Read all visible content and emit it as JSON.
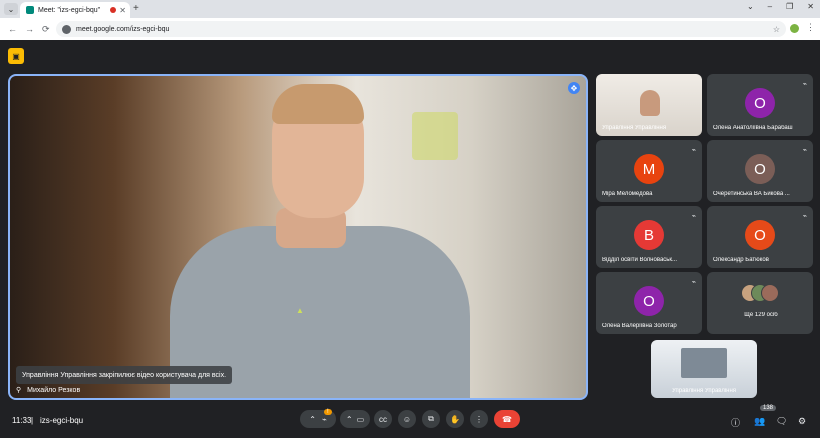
{
  "browser": {
    "tab_title": "Meet: \"izs-egci-bqu\"",
    "new_tab": "+",
    "url": "meet.google.com/izs-egci-bqu",
    "win_controls": [
      "⌄",
      "–",
      "❐",
      "✕"
    ]
  },
  "main": {
    "pin_notice": "Управління Управління закріпилює відео користувача для всіх.",
    "speaker_name": "Михайло Резков"
  },
  "tiles": [
    {
      "name": "Управління Управління",
      "type": "video"
    },
    {
      "name": "Олена Анатоліївна Барабаш",
      "initial": "О",
      "color": "#8e24aa"
    },
    {
      "name": "Міра Меломедова",
      "initial": "М",
      "color": "#e8430f"
    },
    {
      "name": "Очеретинська ВА Бикова ...",
      "initial": "О",
      "color": "#7b5e57"
    },
    {
      "name": "Відділ освіти Волноваськ...",
      "initial": "В",
      "color": "#e53935"
    },
    {
      "name": "Олександр Батюков",
      "initial": "О",
      "color": "#e64a19"
    },
    {
      "name": "Олена Валеріївна Золотар",
      "initial": "О",
      "color": "#8e24aa"
    },
    {
      "name": "Ще 129 осіб",
      "type": "group"
    }
  ],
  "self_view": {
    "name": "Управління Управління"
  },
  "bottom": {
    "time": "11:33",
    "separator": "|",
    "code": "izs-egci-bqu",
    "participants_badge": "138",
    "mic_badge": "!"
  },
  "icons": {
    "pin": "pin-icon",
    "mic_off": "mic-off-icon",
    "camera": "camera-icon",
    "captions": "captions-icon",
    "emoji": "emoji-icon",
    "present": "present-icon",
    "hand": "raise-hand-icon",
    "more": "more-icon",
    "leave": "end-call-icon",
    "info": "info-icon",
    "people": "people-icon",
    "chat": "chat-icon",
    "activities": "activities-icon"
  }
}
